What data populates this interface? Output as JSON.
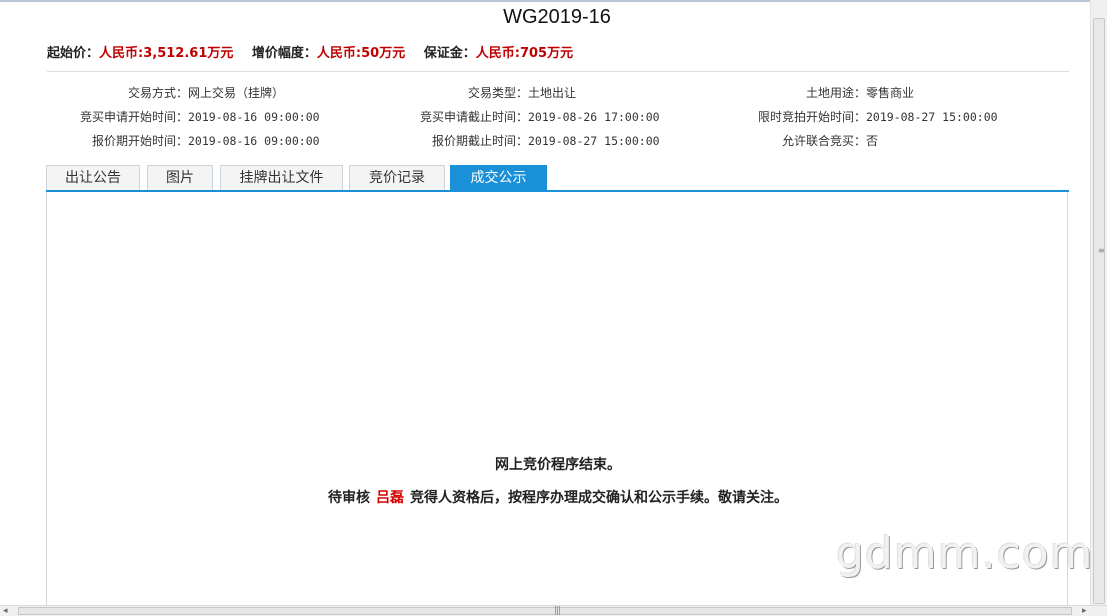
{
  "title": "WG2019-16",
  "price": {
    "start_label": "起始价：",
    "start_value": "人民币:3,512.61万元",
    "increment_label": "增价幅度：",
    "increment_value": "人民币:50万元",
    "deposit_label": "保证金：",
    "deposit_value": "人民币:705万元"
  },
  "info": [
    [
      {
        "label": "交易方式：",
        "value": "网上交易（挂牌）"
      },
      {
        "label": "交易类型：",
        "value": "土地出让"
      },
      {
        "label": "土地用途：",
        "value": "零售商业"
      }
    ],
    [
      {
        "label": "竞买申请开始时间：",
        "value": "2019-08-16 09:00:00"
      },
      {
        "label": "竞买申请截止时间：",
        "value": "2019-08-26 17:00:00"
      },
      {
        "label": "限时竞拍开始时间：",
        "value": "2019-08-27 15:00:00"
      }
    ],
    [
      {
        "label": "报价期开始时间：",
        "value": "2019-08-16 09:00:00"
      },
      {
        "label": "报价期截止时间：",
        "value": "2019-08-27 15:00:00"
      },
      {
        "label": "允许联合竞买：",
        "value": "否"
      }
    ]
  ],
  "tabs": [
    {
      "label": "出让公告",
      "active": false
    },
    {
      "label": "图片",
      "active": false
    },
    {
      "label": "挂牌出让文件",
      "active": false
    },
    {
      "label": "竞价记录",
      "active": false
    },
    {
      "label": "成交公示",
      "active": true
    }
  ],
  "panel": {
    "line1": "网上竞价程序结束。",
    "line2_prefix": "待审核",
    "winner": "吕磊",
    "line2_suffix": "竞得人资格后，按程序办理成交确认和公示手续。敬请关注。"
  },
  "watermark": "gdmm.com",
  "colors": {
    "accent": "#1a90d8",
    "price_red": "#c00000",
    "winner_red": "#d40000"
  }
}
